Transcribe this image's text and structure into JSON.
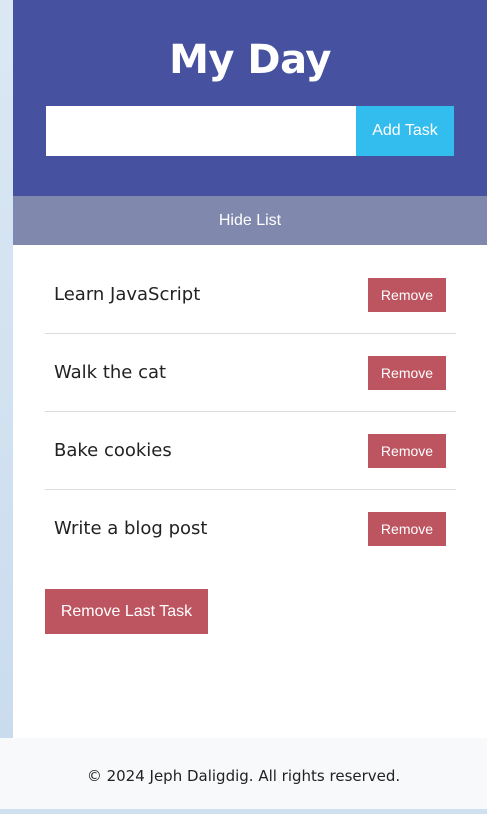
{
  "header": {
    "title": "My Day",
    "input_value": "",
    "input_placeholder": "",
    "add_button_label": "Add Task"
  },
  "toggle": {
    "label": "Hide List"
  },
  "tasks": [
    {
      "text": "Learn JavaScript",
      "remove_label": "Remove"
    },
    {
      "text": "Walk the cat",
      "remove_label": "Remove"
    },
    {
      "text": "Bake cookies",
      "remove_label": "Remove"
    },
    {
      "text": "Write a blog post",
      "remove_label": "Remove"
    }
  ],
  "actions": {
    "remove_last_label": "Remove Last Task"
  },
  "footer": {
    "text": "© 2024 Jeph Daligdig. All rights reserved."
  },
  "colors": {
    "header_bg": "#4651a0",
    "add_button_bg": "#33bcee",
    "toggle_bg": "#8088ad",
    "remove_bg": "#bd5561",
    "footer_bg": "#f8f9fa"
  }
}
